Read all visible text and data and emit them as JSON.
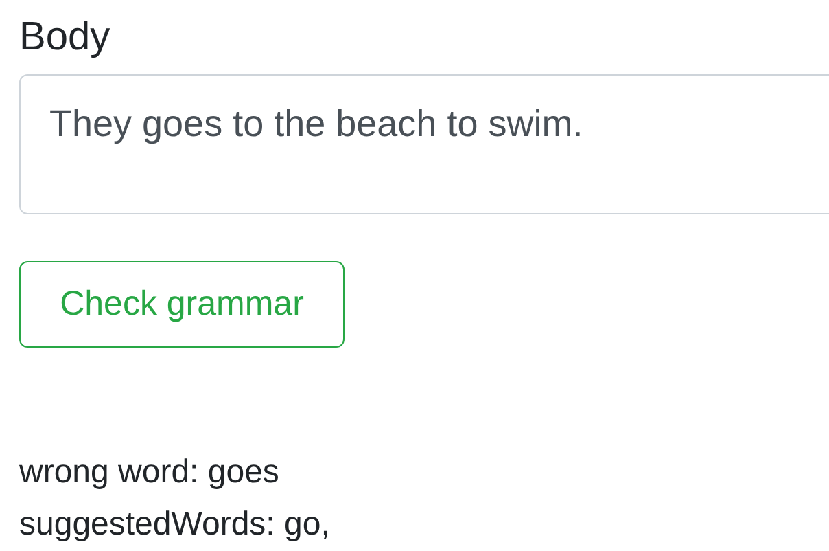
{
  "field": {
    "label": "Body",
    "value": "They goes to the beach to swim."
  },
  "button": {
    "label": "Check grammar"
  },
  "results": [
    {
      "text": "wrong word: goes"
    },
    {
      "text": "suggestedWords: go,"
    }
  ]
}
